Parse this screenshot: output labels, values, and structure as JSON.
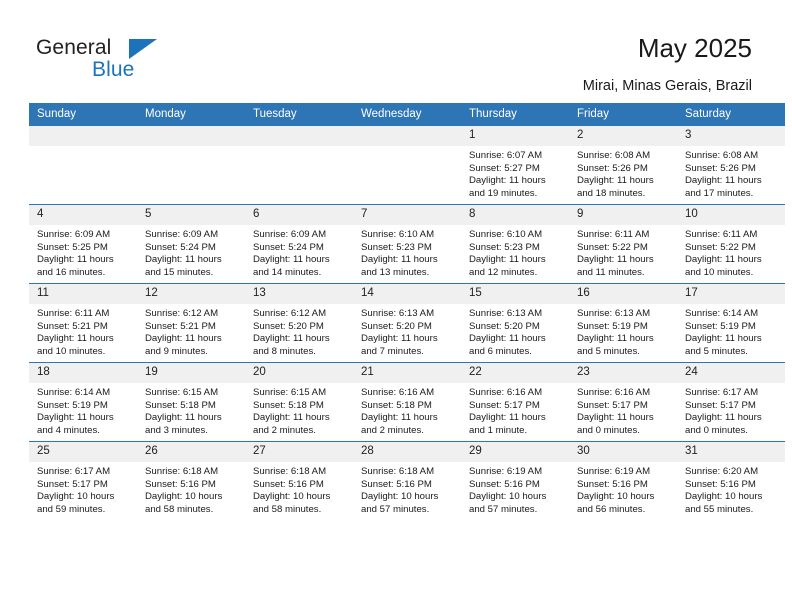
{
  "brand": {
    "name_top": "General",
    "name_bottom": "Blue",
    "accent_color": "#1b74bb"
  },
  "header": {
    "title": "May 2025",
    "subtitle": "Mirai, Minas Gerais, Brazil"
  },
  "theme": {
    "header_row_bg": "#2e75b6",
    "daynum_bg": "#f0f0f0",
    "row_divider": "#2e75b6",
    "text": "#1a1a1a"
  },
  "calendar": {
    "weekday_headers": [
      "Sunday",
      "Monday",
      "Tuesday",
      "Wednesday",
      "Thursday",
      "Friday",
      "Saturday"
    ],
    "weeks": [
      [
        {
          "day": "",
          "empty": true,
          "sunrise": "",
          "sunset": "",
          "daylight_1": "",
          "daylight_2": ""
        },
        {
          "day": "",
          "empty": true,
          "sunrise": "",
          "sunset": "",
          "daylight_1": "",
          "daylight_2": ""
        },
        {
          "day": "",
          "empty": true,
          "sunrise": "",
          "sunset": "",
          "daylight_1": "",
          "daylight_2": ""
        },
        {
          "day": "",
          "empty": true,
          "sunrise": "",
          "sunset": "",
          "daylight_1": "",
          "daylight_2": ""
        },
        {
          "day": "1",
          "empty": false,
          "sunrise": "Sunrise: 6:07 AM",
          "sunset": "Sunset: 5:27 PM",
          "daylight_1": "Daylight: 11 hours",
          "daylight_2": "and 19 minutes."
        },
        {
          "day": "2",
          "empty": false,
          "sunrise": "Sunrise: 6:08 AM",
          "sunset": "Sunset: 5:26 PM",
          "daylight_1": "Daylight: 11 hours",
          "daylight_2": "and 18 minutes."
        },
        {
          "day": "3",
          "empty": false,
          "sunrise": "Sunrise: 6:08 AM",
          "sunset": "Sunset: 5:26 PM",
          "daylight_1": "Daylight: 11 hours",
          "daylight_2": "and 17 minutes."
        }
      ],
      [
        {
          "day": "4",
          "empty": false,
          "sunrise": "Sunrise: 6:09 AM",
          "sunset": "Sunset: 5:25 PM",
          "daylight_1": "Daylight: 11 hours",
          "daylight_2": "and 16 minutes."
        },
        {
          "day": "5",
          "empty": false,
          "sunrise": "Sunrise: 6:09 AM",
          "sunset": "Sunset: 5:24 PM",
          "daylight_1": "Daylight: 11 hours",
          "daylight_2": "and 15 minutes."
        },
        {
          "day": "6",
          "empty": false,
          "sunrise": "Sunrise: 6:09 AM",
          "sunset": "Sunset: 5:24 PM",
          "daylight_1": "Daylight: 11 hours",
          "daylight_2": "and 14 minutes."
        },
        {
          "day": "7",
          "empty": false,
          "sunrise": "Sunrise: 6:10 AM",
          "sunset": "Sunset: 5:23 PM",
          "daylight_1": "Daylight: 11 hours",
          "daylight_2": "and 13 minutes."
        },
        {
          "day": "8",
          "empty": false,
          "sunrise": "Sunrise: 6:10 AM",
          "sunset": "Sunset: 5:23 PM",
          "daylight_1": "Daylight: 11 hours",
          "daylight_2": "and 12 minutes."
        },
        {
          "day": "9",
          "empty": false,
          "sunrise": "Sunrise: 6:11 AM",
          "sunset": "Sunset: 5:22 PM",
          "daylight_1": "Daylight: 11 hours",
          "daylight_2": "and 11 minutes."
        },
        {
          "day": "10",
          "empty": false,
          "sunrise": "Sunrise: 6:11 AM",
          "sunset": "Sunset: 5:22 PM",
          "daylight_1": "Daylight: 11 hours",
          "daylight_2": "and 10 minutes."
        }
      ],
      [
        {
          "day": "11",
          "empty": false,
          "sunrise": "Sunrise: 6:11 AM",
          "sunset": "Sunset: 5:21 PM",
          "daylight_1": "Daylight: 11 hours",
          "daylight_2": "and 10 minutes."
        },
        {
          "day": "12",
          "empty": false,
          "sunrise": "Sunrise: 6:12 AM",
          "sunset": "Sunset: 5:21 PM",
          "daylight_1": "Daylight: 11 hours",
          "daylight_2": "and 9 minutes."
        },
        {
          "day": "13",
          "empty": false,
          "sunrise": "Sunrise: 6:12 AM",
          "sunset": "Sunset: 5:20 PM",
          "daylight_1": "Daylight: 11 hours",
          "daylight_2": "and 8 minutes."
        },
        {
          "day": "14",
          "empty": false,
          "sunrise": "Sunrise: 6:13 AM",
          "sunset": "Sunset: 5:20 PM",
          "daylight_1": "Daylight: 11 hours",
          "daylight_2": "and 7 minutes."
        },
        {
          "day": "15",
          "empty": false,
          "sunrise": "Sunrise: 6:13 AM",
          "sunset": "Sunset: 5:20 PM",
          "daylight_1": "Daylight: 11 hours",
          "daylight_2": "and 6 minutes."
        },
        {
          "day": "16",
          "empty": false,
          "sunrise": "Sunrise: 6:13 AM",
          "sunset": "Sunset: 5:19 PM",
          "daylight_1": "Daylight: 11 hours",
          "daylight_2": "and 5 minutes."
        },
        {
          "day": "17",
          "empty": false,
          "sunrise": "Sunrise: 6:14 AM",
          "sunset": "Sunset: 5:19 PM",
          "daylight_1": "Daylight: 11 hours",
          "daylight_2": "and 5 minutes."
        }
      ],
      [
        {
          "day": "18",
          "empty": false,
          "sunrise": "Sunrise: 6:14 AM",
          "sunset": "Sunset: 5:19 PM",
          "daylight_1": "Daylight: 11 hours",
          "daylight_2": "and 4 minutes."
        },
        {
          "day": "19",
          "empty": false,
          "sunrise": "Sunrise: 6:15 AM",
          "sunset": "Sunset: 5:18 PM",
          "daylight_1": "Daylight: 11 hours",
          "daylight_2": "and 3 minutes."
        },
        {
          "day": "20",
          "empty": false,
          "sunrise": "Sunrise: 6:15 AM",
          "sunset": "Sunset: 5:18 PM",
          "daylight_1": "Daylight: 11 hours",
          "daylight_2": "and 2 minutes."
        },
        {
          "day": "21",
          "empty": false,
          "sunrise": "Sunrise: 6:16 AM",
          "sunset": "Sunset: 5:18 PM",
          "daylight_1": "Daylight: 11 hours",
          "daylight_2": "and 2 minutes."
        },
        {
          "day": "22",
          "empty": false,
          "sunrise": "Sunrise: 6:16 AM",
          "sunset": "Sunset: 5:17 PM",
          "daylight_1": "Daylight: 11 hours",
          "daylight_2": "and 1 minute."
        },
        {
          "day": "23",
          "empty": false,
          "sunrise": "Sunrise: 6:16 AM",
          "sunset": "Sunset: 5:17 PM",
          "daylight_1": "Daylight: 11 hours",
          "daylight_2": "and 0 minutes."
        },
        {
          "day": "24",
          "empty": false,
          "sunrise": "Sunrise: 6:17 AM",
          "sunset": "Sunset: 5:17 PM",
          "daylight_1": "Daylight: 11 hours",
          "daylight_2": "and 0 minutes."
        }
      ],
      [
        {
          "day": "25",
          "empty": false,
          "sunrise": "Sunrise: 6:17 AM",
          "sunset": "Sunset: 5:17 PM",
          "daylight_1": "Daylight: 10 hours",
          "daylight_2": "and 59 minutes."
        },
        {
          "day": "26",
          "empty": false,
          "sunrise": "Sunrise: 6:18 AM",
          "sunset": "Sunset: 5:16 PM",
          "daylight_1": "Daylight: 10 hours",
          "daylight_2": "and 58 minutes."
        },
        {
          "day": "27",
          "empty": false,
          "sunrise": "Sunrise: 6:18 AM",
          "sunset": "Sunset: 5:16 PM",
          "daylight_1": "Daylight: 10 hours",
          "daylight_2": "and 58 minutes."
        },
        {
          "day": "28",
          "empty": false,
          "sunrise": "Sunrise: 6:18 AM",
          "sunset": "Sunset: 5:16 PM",
          "daylight_1": "Daylight: 10 hours",
          "daylight_2": "and 57 minutes."
        },
        {
          "day": "29",
          "empty": false,
          "sunrise": "Sunrise: 6:19 AM",
          "sunset": "Sunset: 5:16 PM",
          "daylight_1": "Daylight: 10 hours",
          "daylight_2": "and 57 minutes."
        },
        {
          "day": "30",
          "empty": false,
          "sunrise": "Sunrise: 6:19 AM",
          "sunset": "Sunset: 5:16 PM",
          "daylight_1": "Daylight: 10 hours",
          "daylight_2": "and 56 minutes."
        },
        {
          "day": "31",
          "empty": false,
          "sunrise": "Sunrise: 6:20 AM",
          "sunset": "Sunset: 5:16 PM",
          "daylight_1": "Daylight: 10 hours",
          "daylight_2": "and 55 minutes."
        }
      ]
    ]
  }
}
